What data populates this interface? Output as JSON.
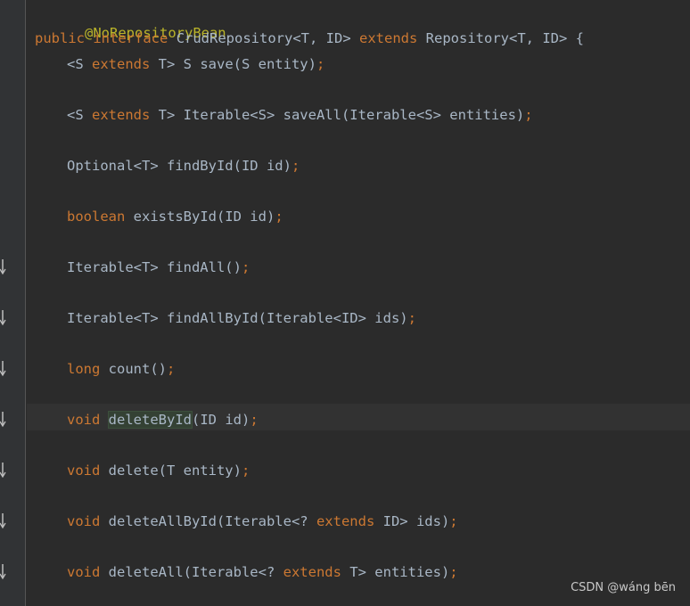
{
  "code": {
    "annotation": "@NoRepositoryBean",
    "declaration": {
      "kw_public": "public",
      "kw_interface": "interface",
      "name": "CrudRepository<T, ID>",
      "kw_extends": "extends",
      "parent": "Repository<T, ID> {"
    },
    "methods": [
      {
        "parts": [
          [
            "plain",
            "<S "
          ],
          [
            "kw",
            "extends"
          ],
          [
            "plain",
            " T> S save(S entity)"
          ],
          [
            "punct",
            ";"
          ]
        ]
      },
      {
        "parts": [
          [
            "plain",
            "<S "
          ],
          [
            "kw",
            "extends"
          ],
          [
            "plain",
            " T> Iterable<S> saveAll(Iterable<S> entities)"
          ],
          [
            "punct",
            ";"
          ]
        ]
      },
      {
        "parts": [
          [
            "plain",
            "Optional<T> findById(ID id)"
          ],
          [
            "punct",
            ";"
          ]
        ]
      },
      {
        "parts": [
          [
            "kw",
            "boolean"
          ],
          [
            "plain",
            " existsById(ID id)"
          ],
          [
            "punct",
            ";"
          ]
        ]
      },
      {
        "parts": [
          [
            "plain",
            "Iterable<T> findAll()"
          ],
          [
            "punct",
            ";"
          ]
        ]
      },
      {
        "parts": [
          [
            "plain",
            "Iterable<T> findAllById(Iterable<ID> ids)"
          ],
          [
            "punct",
            ";"
          ]
        ]
      },
      {
        "parts": [
          [
            "kw",
            "long"
          ],
          [
            "plain",
            " count()"
          ],
          [
            "punct",
            ";"
          ]
        ]
      },
      {
        "parts": [
          [
            "kw",
            "void"
          ],
          [
            "plain",
            " "
          ],
          [
            "hl",
            "deleteById"
          ],
          [
            "plain",
            "(ID id)"
          ],
          [
            "punct",
            ";"
          ]
        ]
      },
      {
        "parts": [
          [
            "kw",
            "void"
          ],
          [
            "plain",
            " delete(T entity)"
          ],
          [
            "punct",
            ";"
          ]
        ]
      },
      {
        "parts": [
          [
            "kw",
            "void"
          ],
          [
            "plain",
            " deleteAllById(Iterable<? "
          ],
          [
            "kw",
            "extends"
          ],
          [
            "plain",
            " ID> ids)"
          ],
          [
            "punct",
            ";"
          ]
        ]
      },
      {
        "parts": [
          [
            "kw",
            "void"
          ],
          [
            "plain",
            " deleteAll(Iterable<? "
          ],
          [
            "kw",
            "extends"
          ],
          [
            "plain",
            " T> entities)"
          ],
          [
            "punct",
            ";"
          ]
        ]
      }
    ]
  },
  "gutter": {
    "icon": "implementation-down-arrow-icon",
    "marked_methods": [
      4,
      5,
      6,
      7,
      8,
      9,
      10
    ]
  },
  "watermark": "CSDN @wáng bēn",
  "colors": {
    "background": "#2b2b2b",
    "gutter": "#313335",
    "keyword": "#cc7832",
    "annotation": "#bbb529",
    "text": "#a9b7c6",
    "caret_row": "#323232",
    "highlight": "#344134"
  }
}
